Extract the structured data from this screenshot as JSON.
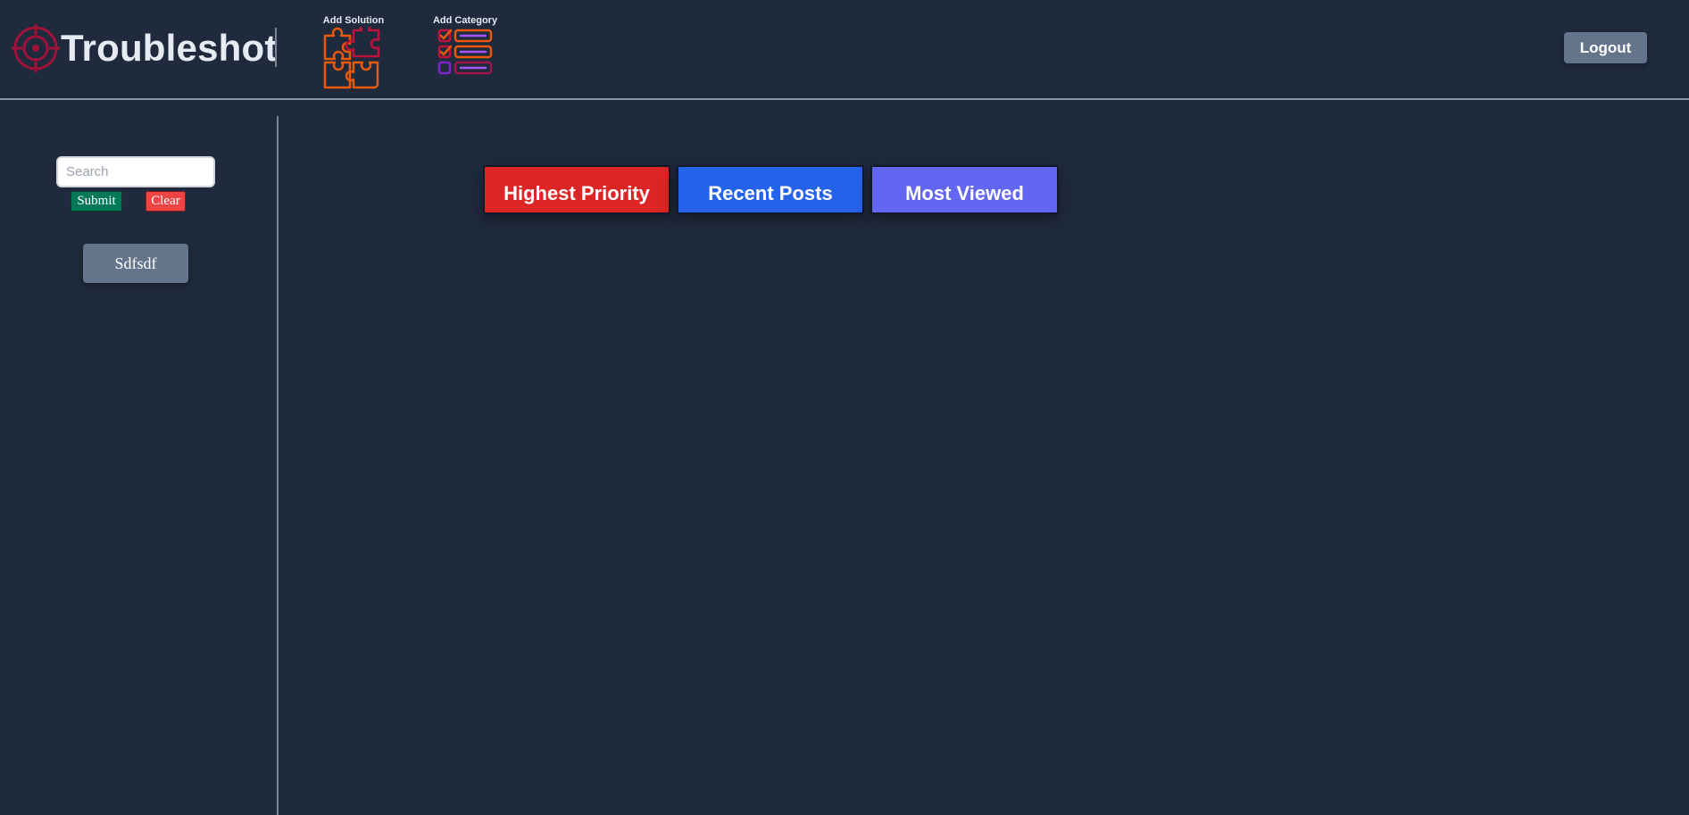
{
  "header": {
    "brand_title": "Troubleshot",
    "brand_icon": "crosshair-target-icon",
    "nav": [
      {
        "label": "Add Solution",
        "icon": "puzzle-pieces-icon"
      },
      {
        "label": "Add Category",
        "icon": "checklist-icon"
      }
    ],
    "logout_label": "Logout"
  },
  "sidebar": {
    "search": {
      "placeholder": "Search",
      "value": ""
    },
    "submit_label": "Submit",
    "clear_label": "Clear",
    "categories": [
      {
        "label": "Sdfsdf"
      }
    ]
  },
  "main": {
    "filters": [
      {
        "label": "Highest Priority",
        "color": "#dc2626"
      },
      {
        "label": "Recent Posts",
        "color": "#2563eb"
      },
      {
        "label": "Most Viewed",
        "color": "#6366f1"
      }
    ]
  },
  "colors": {
    "background": "#1f2a3c",
    "brand_icon": "#9f1239",
    "nav_icon_accent": "#ea580c",
    "nav_icon_secondary": "#a855f7",
    "muted_button": "#64748b",
    "submit": "#047857",
    "clear": "#ef4444"
  }
}
